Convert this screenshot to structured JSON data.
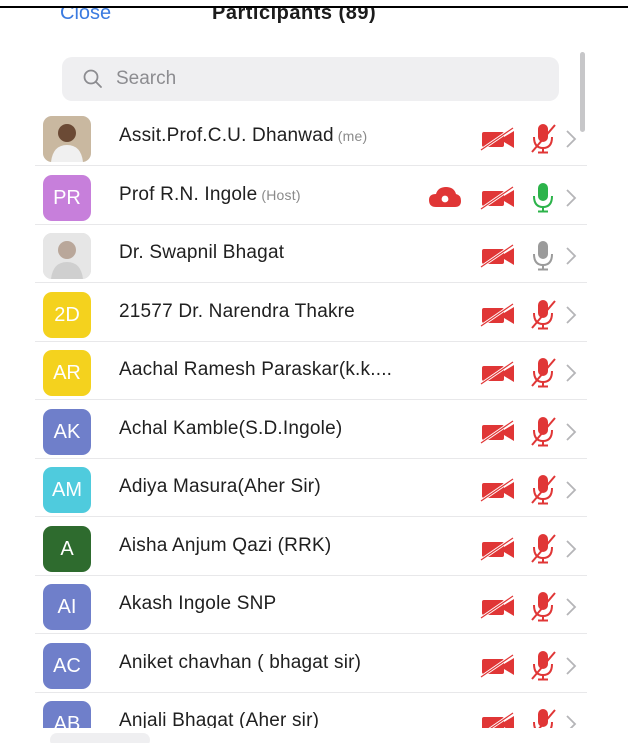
{
  "header": {
    "close_label": "Close",
    "title": "Participants (89)"
  },
  "search": {
    "placeholder": "Search"
  },
  "colors": {
    "accent": "#3b7be0",
    "muted_red": "#e03636",
    "unmuted_green": "#2cb34a",
    "mic_grey": "#9b9b9b"
  },
  "participants": [
    {
      "name": "Assit.Prof.C.U. Dhanwad",
      "tag": "(me)",
      "initials": "",
      "avatar": "photo",
      "video": "off",
      "mic": "muted",
      "recording": false
    },
    {
      "name": "Prof R.N. Ingole",
      "tag": "(Host)",
      "initials": "PR",
      "avatar_color": "#c77fdb",
      "video": "off",
      "mic": "unmuted",
      "recording": true
    },
    {
      "name": "Dr. Swapnil Bhagat",
      "tag": "",
      "initials": "",
      "avatar": "photo",
      "video": "off",
      "mic": "grey",
      "recording": false
    },
    {
      "name": "21577 Dr. Narendra Thakre",
      "tag": "",
      "initials": "2D",
      "avatar_color": "#f4d21e",
      "video": "off",
      "mic": "muted",
      "recording": false
    },
    {
      "name": "Aachal Ramesh Paraskar(k.k....",
      "tag": "",
      "initials": "AR",
      "avatar_color": "#f4d21e",
      "video": "off",
      "mic": "muted",
      "recording": false
    },
    {
      "name": "Achal Kamble(S.D.Ingole)",
      "tag": "",
      "initials": "AK",
      "avatar_color": "#6f7fca",
      "video": "off",
      "mic": "muted",
      "recording": false
    },
    {
      "name": "Adiya Masura(Aher Sir)",
      "tag": "",
      "initials": "AM",
      "avatar_color": "#4fcbdd",
      "video": "off",
      "mic": "muted",
      "recording": false
    },
    {
      "name": "Aisha Anjum Qazi (RRK)",
      "tag": "",
      "initials": "A",
      "avatar_color": "#2e6b2e",
      "video": "off",
      "mic": "muted",
      "recording": false
    },
    {
      "name": "Akash Ingole SNP",
      "tag": "",
      "initials": "AI",
      "avatar_color": "#6f7fca",
      "video": "off",
      "mic": "muted",
      "recording": false
    },
    {
      "name": "Aniket chavhan ( bhagat sir)",
      "tag": "",
      "initials": "AC",
      "avatar_color": "#6f7fca",
      "video": "off",
      "mic": "muted",
      "recording": false
    },
    {
      "name": "Anjali Bhagat (Aher sir)",
      "tag": "",
      "initials": "AB",
      "avatar_color": "#6f7fca",
      "video": "off",
      "mic": "muted",
      "recording": false
    }
  ]
}
